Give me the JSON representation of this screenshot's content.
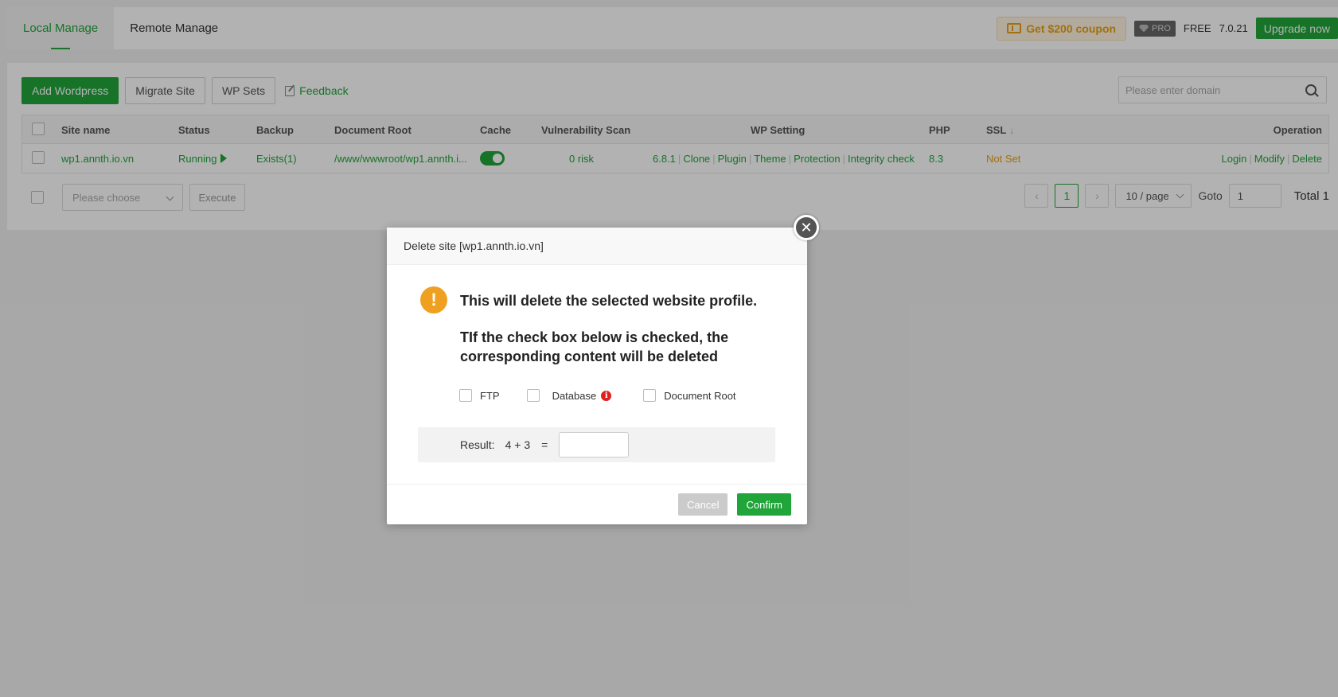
{
  "tabs": [
    {
      "label": "Local Manage",
      "active": true
    },
    {
      "label": "Remote Manage",
      "active": false
    }
  ],
  "header": {
    "coupon_label": "Get $200 coupon",
    "pro_label": "PRO",
    "free_label": "FREE",
    "version": "7.0.21",
    "upgrade_label": "Upgrade now"
  },
  "toolbar": {
    "add_wordpress": "Add Wordpress",
    "migrate_site": "Migrate Site",
    "wp_sets": "WP Sets",
    "feedback": "Feedback"
  },
  "search": {
    "placeholder": "Please enter domain"
  },
  "table": {
    "columns": {
      "site_name": "Site name",
      "status": "Status",
      "backup": "Backup",
      "document_root": "Document Root",
      "cache": "Cache",
      "vulnerability_scan": "Vulnerability Scan",
      "wp_setting": "WP Setting",
      "php": "PHP",
      "ssl": "SSL",
      "operation": "Operation"
    },
    "rows": [
      {
        "site_name": "wp1.annth.io.vn",
        "status": "Running",
        "backup": "Exists(1)",
        "document_root": "/www/wwwroot/wp1.annth.i...",
        "cache_enabled": true,
        "vulnerability": "0 risk",
        "wp_version": "6.8.1",
        "wp_actions": [
          "Clone",
          "Plugin",
          "Theme",
          "Protection",
          "Integrity check"
        ],
        "php": "8.3",
        "ssl": "Not Set",
        "operations": [
          "Login",
          "Modify",
          "Delete"
        ]
      }
    ]
  },
  "batch": {
    "select_placeholder": "Please choose",
    "execute_label": "Execute"
  },
  "pagination": {
    "current_page": "1",
    "page_size": "10 / page",
    "goto_label": "Goto",
    "goto_value": "1",
    "total_label": "Total 1"
  },
  "modal": {
    "title": "Delete site [wp1.annth.io.vn]",
    "message1": "This will delete the selected website profile.",
    "message2": "TIf the check box below is checked, the corresponding content will be deleted",
    "options": [
      "FTP",
      "Database",
      "Document Root"
    ],
    "result_label": "Result:",
    "expression": "4 + 3",
    "equals": "=",
    "result_value": "",
    "cancel_label": "Cancel",
    "confirm_label": "Confirm"
  },
  "colors": {
    "accent": "#20a53a",
    "warning": "#f0a020",
    "coupon": "#e8a116",
    "danger": "#e02020"
  }
}
